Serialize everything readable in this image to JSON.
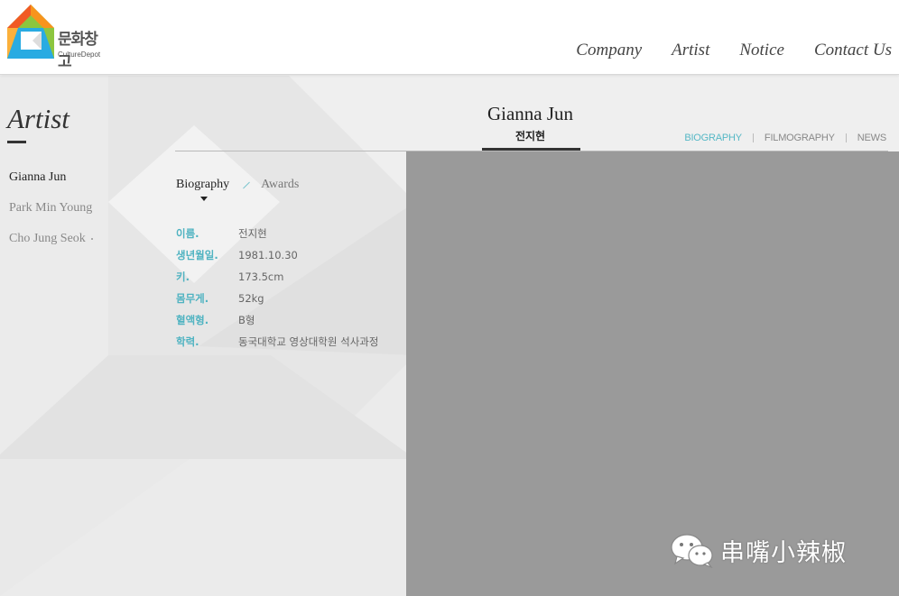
{
  "header": {
    "logo": {
      "korean": "문화창고",
      "english": "CultureDepot"
    },
    "nav": [
      "Company",
      "Artist",
      "Notice",
      "Contact Us"
    ]
  },
  "sidebar": {
    "title": "Artist",
    "items": [
      {
        "label": "Gianna Jun",
        "active": true
      },
      {
        "label": "Park Min Young",
        "active": false
      },
      {
        "label": "Cho Jung Seok",
        "active": false
      }
    ]
  },
  "artist": {
    "name_en": "Gianna Jun",
    "name_ko": "전지현"
  },
  "tabs": [
    {
      "label": "BIOGRAPHY",
      "active": true
    },
    {
      "label": "FILMOGRAPHY",
      "active": false
    },
    {
      "label": "NEWS",
      "active": false
    }
  ],
  "subtabs": [
    {
      "label": "Biography",
      "active": true
    },
    {
      "label": "Awards",
      "active": false
    }
  ],
  "info": [
    {
      "label": "이름.",
      "value": "전지현"
    },
    {
      "label": "생년월일.",
      "value": "1981.10.30"
    },
    {
      "label": "키.",
      "value": "173.5cm"
    },
    {
      "label": "몸무게.",
      "value": "52kg"
    },
    {
      "label": "혈액형.",
      "value": "B형"
    },
    {
      "label": "학력.",
      "value": "동국대학교 영상대학원 석사과정"
    }
  ],
  "watermark": {
    "text": "串嘴小辣椒",
    "icon": "wechat-icon"
  },
  "colors": {
    "accent": "#56b8c6",
    "background": "#efefef",
    "header": "#ffffff"
  }
}
